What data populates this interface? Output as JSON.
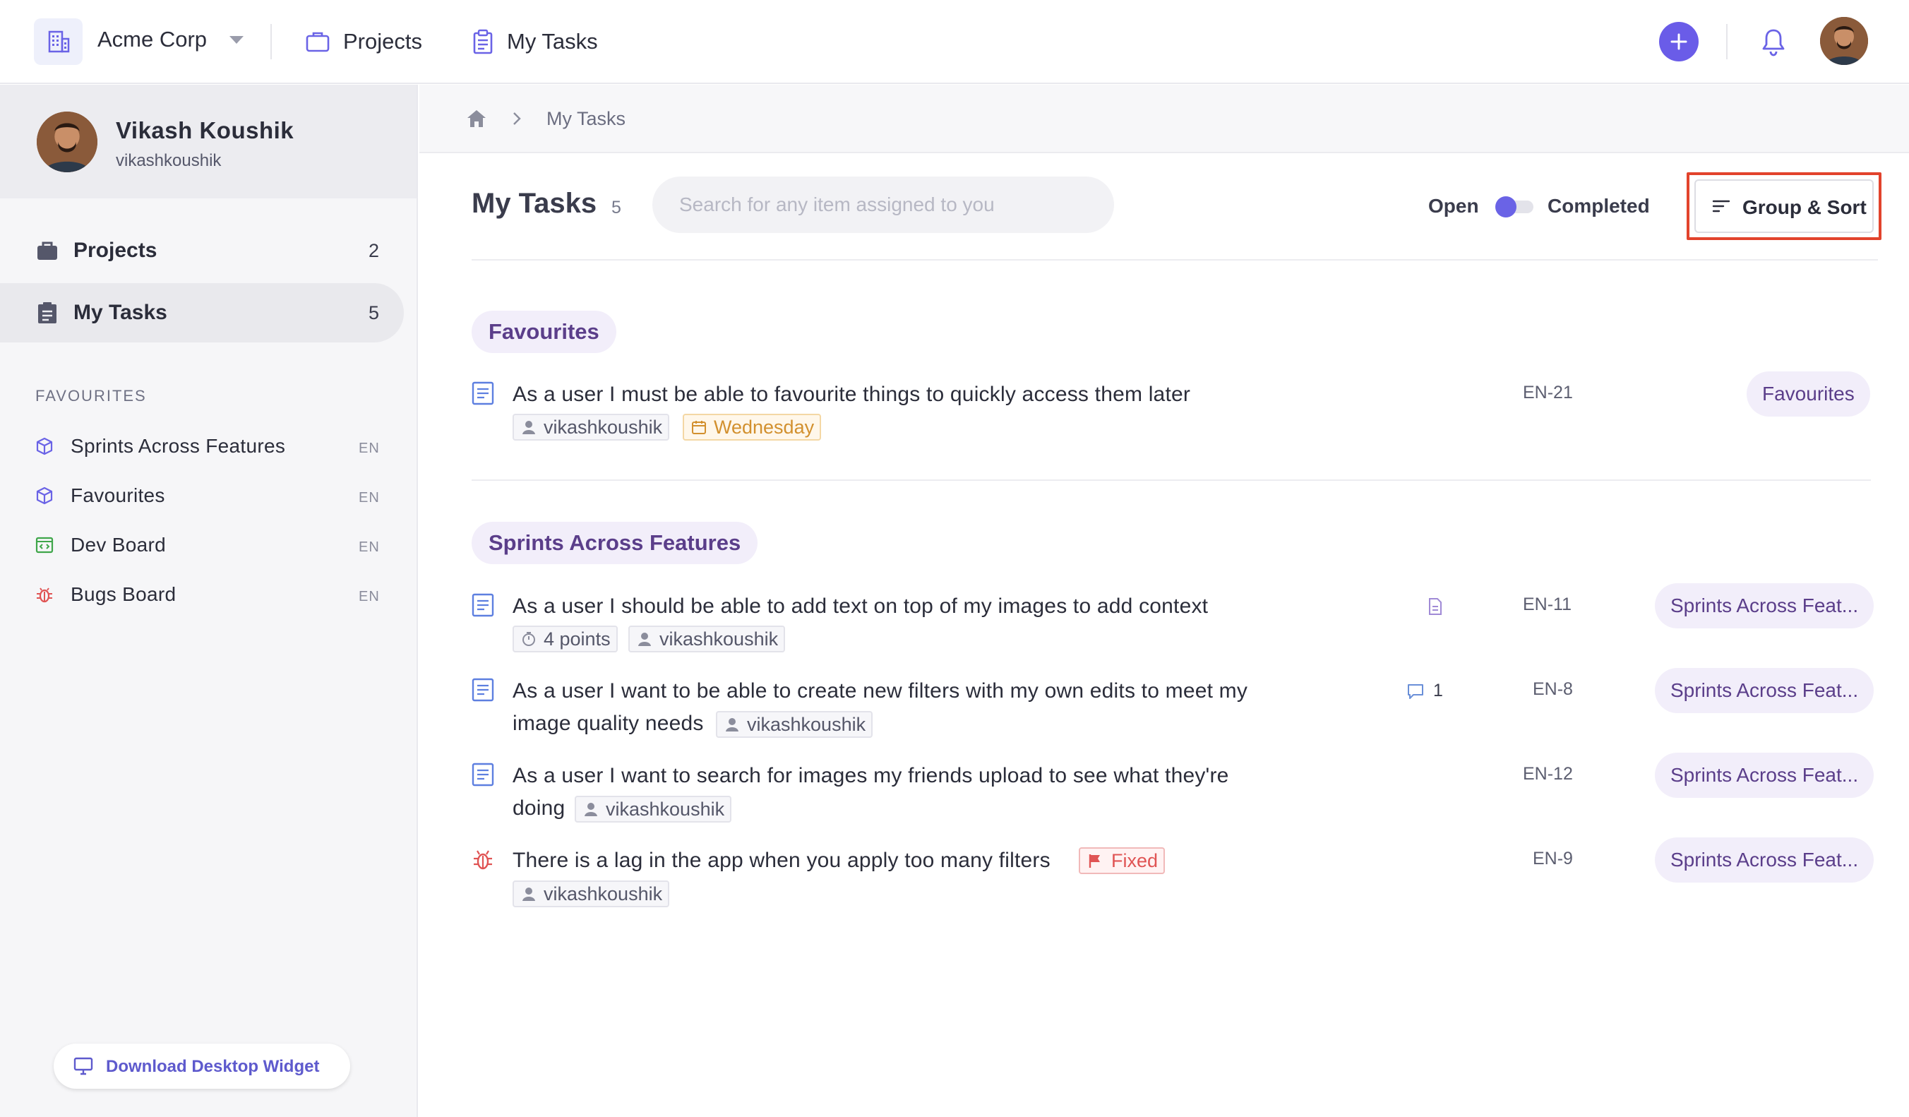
{
  "topbar": {
    "org_name": "Acme Corp",
    "nav_projects": "Projects",
    "nav_my_tasks": "My Tasks",
    "accent_color": "#6a5ce8"
  },
  "sidebar": {
    "profile": {
      "name": "Vikash Koushik",
      "username": "vikashkoushik"
    },
    "nav": [
      {
        "label": "Projects",
        "count": "2",
        "icon": "briefcase-icon"
      },
      {
        "label": "My Tasks",
        "count": "5",
        "icon": "clipboard-icon"
      }
    ],
    "favourites_heading": "FAVOURITES",
    "favourites": [
      {
        "label": "Sprints Across Features",
        "tag": "EN",
        "icon": "cube-icon"
      },
      {
        "label": "Favourites",
        "tag": "EN",
        "icon": "cube-icon"
      },
      {
        "label": "Dev Board",
        "tag": "EN",
        "icon": "code-board-icon"
      },
      {
        "label": "Bugs Board",
        "tag": "EN",
        "icon": "bug-icon"
      }
    ],
    "download_label": "Download Desktop Widget"
  },
  "breadcrumb": {
    "current": "My Tasks"
  },
  "main": {
    "title": "My Tasks",
    "count": "5",
    "search_placeholder": "Search for any item assigned to you",
    "toggle_open": "Open",
    "toggle_completed": "Completed",
    "toggle_state": "open",
    "group_sort_label": "Group & Sort",
    "groups": [
      {
        "name": "Favourites",
        "tasks": [
          {
            "title": "As a user I must be able to favourite things to quickly access them later",
            "assignee": "vikashkoushik",
            "due": "Wednesday",
            "key": "EN-21",
            "project": "Favourites"
          }
        ]
      },
      {
        "name": "Sprints Across Features",
        "tasks": [
          {
            "title": "As a user I should be able to add text on top of my images to add context",
            "points": "4 points",
            "assignee": "vikashkoushik",
            "key": "EN-11",
            "project": "Sprints Across Feat..."
          },
          {
            "title_line1": "As a user I want to be able to create new filters with my own edits to meet my",
            "title_line2": "image quality needs",
            "assignee": "vikashkoushik",
            "comments": "1",
            "key": "EN-8",
            "project": "Sprints Across Feat..."
          },
          {
            "title_line1": "As a user I want to search for images my friends upload to see what they're",
            "title_line2": "doing",
            "assignee": "vikashkoushik",
            "key": "EN-12",
            "project": "Sprints Across Feat..."
          },
          {
            "title": "There is a lag in the app when you apply too many filters",
            "status": "Fixed",
            "assignee": "vikashkoushik",
            "key": "EN-9",
            "project": "Sprints Across Feat..."
          }
        ]
      }
    ]
  }
}
